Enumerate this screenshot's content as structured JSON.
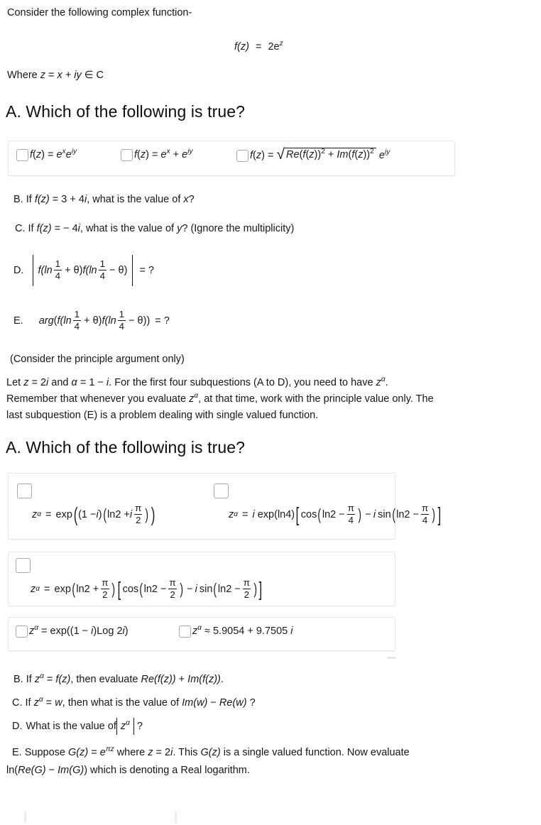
{
  "document": {
    "intro_line": "Consider the following complex function-",
    "center_equation": {
      "lhs": "f(z)",
      "eq": "=",
      "rhs_base": "2e",
      "rhs_exp": "z"
    },
    "where_line": {
      "prefix": "Where ",
      "z": "z",
      "eq": " = ",
      "expr": "x + iy",
      "member": " ∈ C"
    }
  },
  "section1": {
    "heading": "A. Which of the following is true?",
    "options": [
      {
        "id": "s1-opt1",
        "text": "f(z) = e^x e^{iy}"
      },
      {
        "id": "s1-opt2",
        "text": "f(z) = e^x + e^{iy}"
      },
      {
        "id": "s1-opt3",
        "text": "f(z) = sqrt(Re(f(z))^2 + Im(f(z))^2) e^{iy}"
      }
    ],
    "sub_b": {
      "label": "B.",
      "text_1": "If ",
      "fz": "f(z)",
      "text_2": " = 3 + 4",
      "i": "i",
      "text_3": ", what is the value of ",
      "x": "x",
      "text_4": "?"
    },
    "sub_c": {
      "label": "C.",
      "text_1": "If ",
      "fz": "f(z)",
      "text_2": " =  − 4",
      "i": "i",
      "text_3": ", what is the value of ",
      "y": "y",
      "text_4": "? (Ignore the multiplicity)"
    },
    "sub_d": {
      "label": "D.",
      "f1": "f(ln",
      "num": "1",
      "den": "4",
      "plus": "+ θ)",
      "f2": "f(ln",
      "minus": "− θ)",
      "tail": "= ?"
    },
    "sub_e": {
      "label": "E.",
      "arg": "arg",
      "f1": "f(ln",
      "num": "1",
      "den": "4",
      "plus": "+ θ)",
      "f2": "f(ln",
      "minus": "− θ))",
      "tail": "= ?"
    },
    "note": "(Consider the principle argument only)"
  },
  "section2": {
    "paragraph_line1": {
      "a": "Let ",
      "z": "z",
      "b": " = 2",
      "i1": "i",
      "c": " and ",
      "alpha": "α",
      "d": " = 1 − ",
      "i2": "i",
      "e": ". For the first four subquestions (A to D), you need to have ",
      "za": "z",
      "sup": "α",
      "f": "."
    },
    "paragraph_line2": {
      "a": "Remember that whenever you evaluate ",
      "za": "z",
      "sup": "α",
      "b": ", at that time, work with the principle value only. The"
    },
    "paragraph_line3": {
      "a": "last subquestion (E) is a problem dealing with single valued function."
    },
    "heading": "A. Which of the following is true?",
    "options": [
      {
        "id": "s2-opt1",
        "desc": "z^alpha = exp((1 - i)(ln2 + i pi/2))",
        "lhs": "z",
        "sup": "α",
        "eq": "=",
        "exp": "exp",
        "t1": "(1 − ",
        "i1": "i",
        "t2": ")",
        "ln": "ln2 + ",
        "i2": "i",
        "pi": "π",
        "two": "2"
      },
      {
        "id": "s2-opt2",
        "desc": "z^alpha = i exp(ln4)[cos(ln2 - pi/4) - i sin(ln2 - pi/4)]",
        "lhs": "z",
        "sup": "α",
        "eq": "=",
        "i0": "i",
        "exp": "exp(ln4)",
        "cos": "cos",
        "ln_a": "ln2 − ",
        "pi": "π",
        "four": "4",
        "minus": "− ",
        "i1": "i",
        "sin": "sin",
        "ln_b": "ln2 − "
      },
      {
        "id": "s2-opt3",
        "desc": "z^alpha = exp(ln2 + pi/2)[cos(ln2 - pi/2) - i sin(ln2 - pi/2)]",
        "lhs": "z",
        "sup": "α",
        "eq": "=",
        "exp": "exp",
        "ln0": "ln2 + ",
        "pi": "π",
        "two": "2",
        "cos": "cos",
        "ln_a": "ln2 − ",
        "minus": "− ",
        "i1": "i",
        "sin": "sin",
        "ln_b": "ln2 − "
      },
      {
        "id": "s2-opt4",
        "desc": "z^alpha = exp((1 - i)Log 2i)",
        "lhs": "z",
        "sup": "α",
        "eq": "= exp((1 − ",
        "i1": "i",
        "mid": ")Log 2",
        "i2": "i",
        "end": ")"
      },
      {
        "id": "s2-opt5",
        "desc": "z^alpha approx 5.9054 + 9.7505 i",
        "lhs": "z",
        "sup": "α",
        "eq": "≈ 5.9054 + 9.7505 ",
        "i1": "i"
      }
    ],
    "sub_b": {
      "label": "B.",
      "t1": "If ",
      "z": "z",
      "sup": "α",
      "t2": " = ",
      "fz": "f(z)",
      "t3": ", then evaluate ",
      "re": "Re(f(z))",
      "t4": " + ",
      "im": "Im(f(z))",
      "t5": "."
    },
    "sub_c": {
      "label": "C.",
      "t1": "If ",
      "z": "z",
      "sup": "α",
      "t2": " = ",
      "w": "w",
      "t3": ", then what is the value of ",
      "im": "Im(w)",
      "t4": " − ",
      "re": "Re(w)",
      "t5": " ?"
    },
    "sub_d": {
      "label": "D.",
      "t1": "What is the value of ",
      "z": "z",
      "sup": "α",
      "t2": "?"
    },
    "sub_e_line1": {
      "label": "E.",
      "t1": " Suppose ",
      "g": "G(z)",
      "t2": " = ",
      "e": "e",
      "sup": "πz",
      "t3": " where ",
      "z": "z",
      "t4": " = 2",
      "i": "i",
      "t5": ". This ",
      "g2": "G(z)",
      "t6": " is a single valued function. Now evaluate"
    },
    "sub_e_line2": {
      "t1": "ln(",
      "re": "Re(G)",
      "t2": " − ",
      "im": "Im(G)",
      "t3": ") which is denoting a Real logarithm."
    }
  },
  "colors": {
    "text": "#161616",
    "box_border": "#e6e6e6",
    "checkbox_border": "#a9a9a9",
    "background": "#ffffff"
  }
}
